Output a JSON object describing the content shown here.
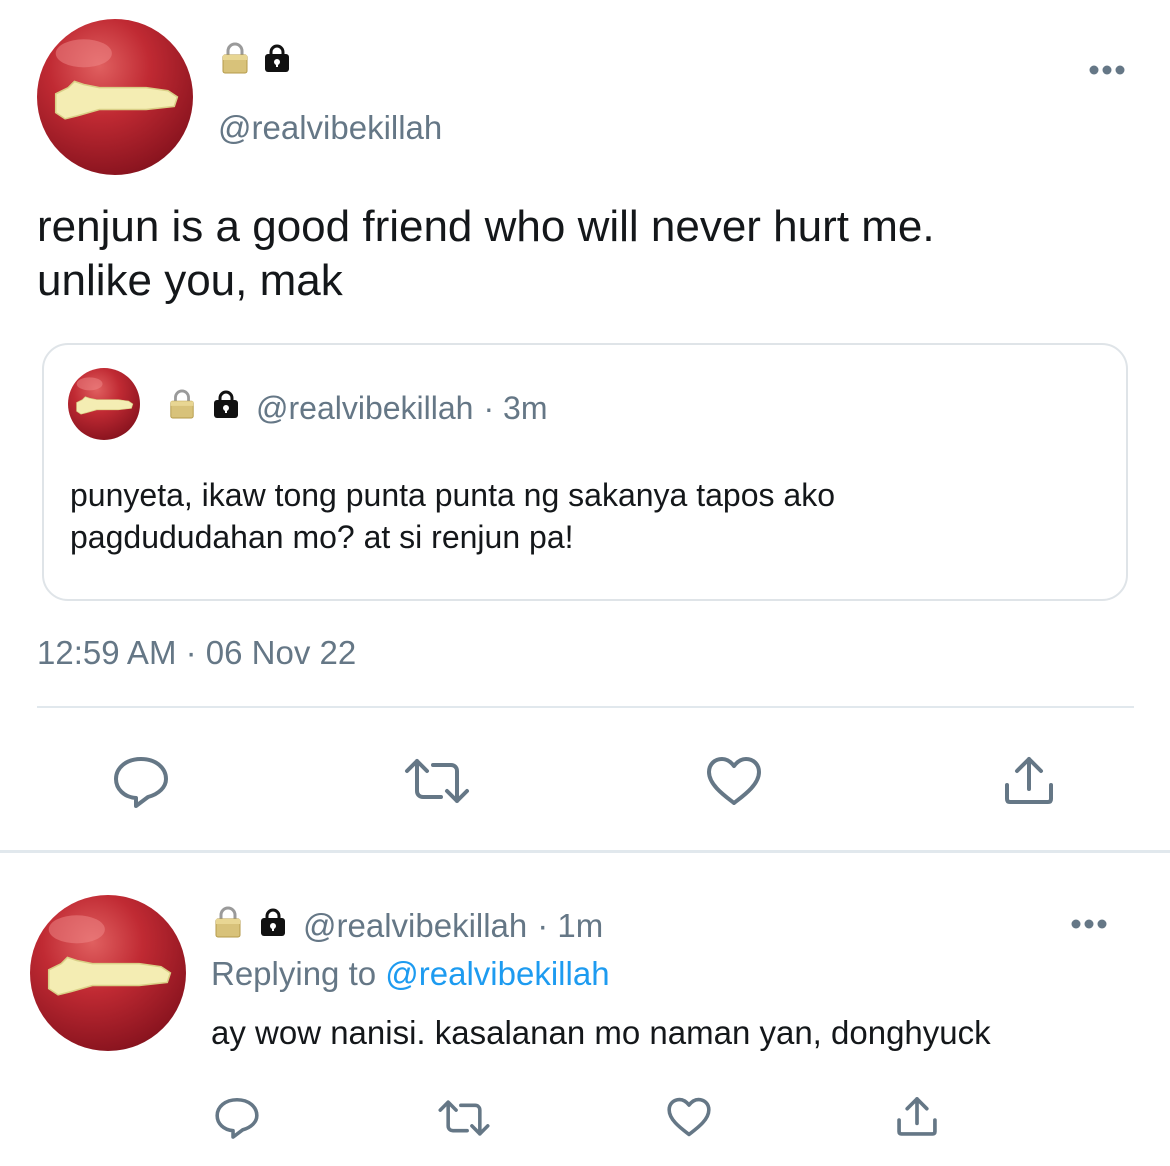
{
  "main_tweet": {
    "handle": "@realvibekillah",
    "text_line1": "renjun is a good friend who will never hurt me.",
    "text_line2": "unlike you, mak",
    "timestamp": "12:59 AM · 06 Nov 22",
    "display_name_icons": [
      "padlock-gold-icon",
      "lock-black-icon"
    ],
    "more_icon": "more-horizontal-icon"
  },
  "quoted_tweet": {
    "handle": "@realvibekillah",
    "time": "· 3m",
    "text_line1": "punyeta, ikaw tong punta punta ng sakanya tapos ako",
    "text_line2": "pagdududahan mo? at si renjun pa!"
  },
  "actions": {
    "icons": [
      "reply-icon",
      "retweet-icon",
      "like-icon",
      "share-icon"
    ]
  },
  "reply_tweet": {
    "handle": "@realvibekillah",
    "time": "· 1m",
    "replying_prefix": "Replying to",
    "replying_to": "@realvibekillah",
    "text": "ay wow nanisi. kasalanan mo naman yan, donghyuck"
  },
  "colors": {
    "text": "#14171a",
    "muted": "#657786",
    "link": "#1d9bf0",
    "border": "#e1e8ed"
  }
}
